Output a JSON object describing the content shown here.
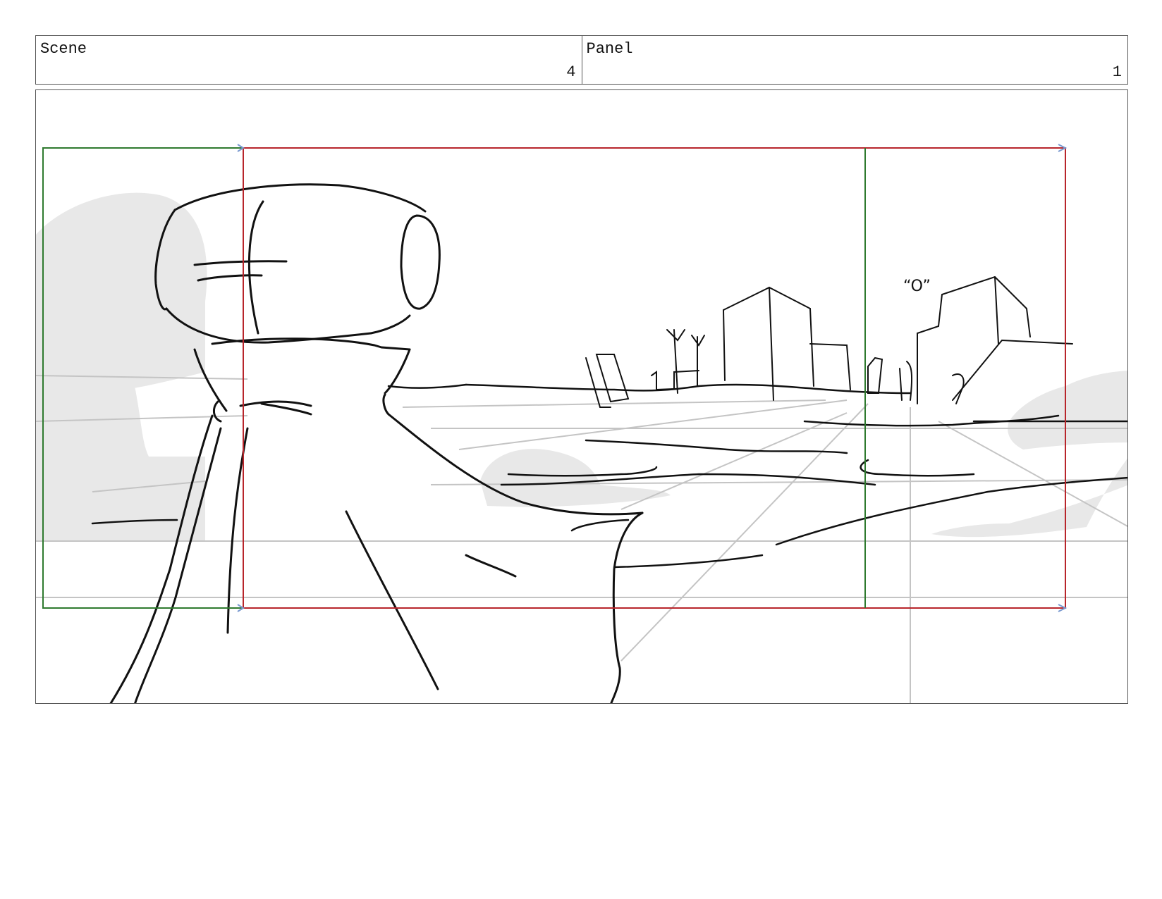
{
  "header": {
    "scene_label": "Scene",
    "scene_number": "4",
    "panel_label": "Panel",
    "panel_number": "1"
  },
  "sketch": {
    "speech_text": "“O”"
  },
  "colors": {
    "frame_green": "#2f7a2f",
    "frame_red": "#b8252b",
    "sketch_line": "#111111",
    "perspective_line": "#c4c4c4",
    "shadow_fill": "#e8e8e8",
    "border": "#555555"
  }
}
